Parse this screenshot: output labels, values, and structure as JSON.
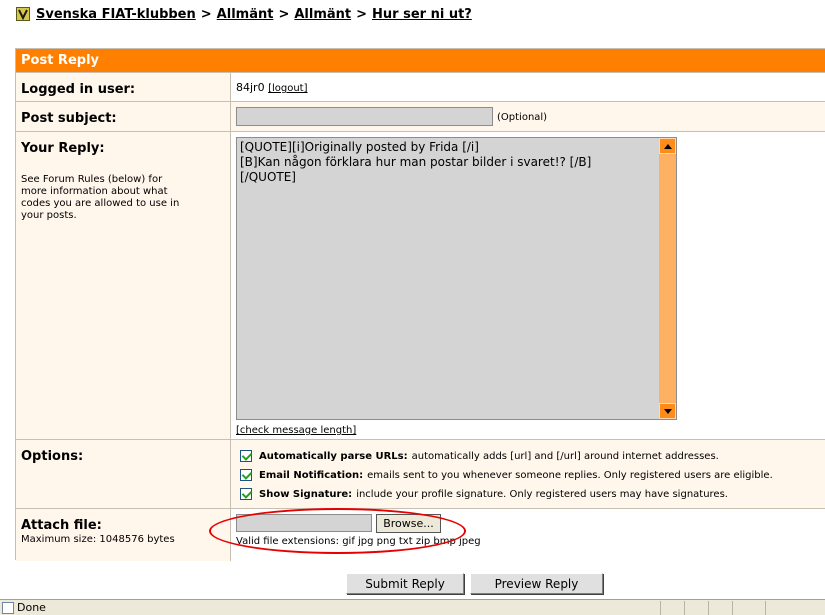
{
  "breadcrumb": {
    "items": [
      "Svenska FIAT-klubben",
      "Allmänt",
      "Allmänt",
      "Hur ser ni ut?"
    ],
    "separator": ">"
  },
  "form": {
    "header": "Post Reply",
    "logged_in": {
      "label": "Logged in user:",
      "username": "84jr0",
      "logout": "[logout]"
    },
    "subject": {
      "label": "Post subject:",
      "value": "",
      "optional": "(Optional)"
    },
    "reply": {
      "label": "Your Reply:",
      "help": "See Forum Rules (below) for more information about what codes you are allowed to use in your posts.",
      "lines": [
        "[QUOTE][i]Originally posted by Frida [/i]",
        "[B]Kan någon förklara hur man postar bilder i svaret!? [/B]",
        "[/QUOTE]"
      ],
      "check_length": "[check message length]"
    },
    "options": {
      "label": "Options:",
      "items": [
        {
          "title": "Automatically parse URLs:",
          "desc": "automatically adds [url] and [/url] around internet addresses.",
          "checked": true
        },
        {
          "title": "Email Notification:",
          "desc": "emails sent to you whenever someone replies. Only registered users are eligible.",
          "checked": true
        },
        {
          "title": "Show Signature:",
          "desc": "include your profile signature. Only registered users may have signatures.",
          "checked": true
        }
      ]
    },
    "attach": {
      "label": "Attach file:",
      "max_size": "Maximum size: 1048576 bytes",
      "browse": "Browse...",
      "extensions": "Valid file extensions: gif jpg png txt zip bmp jpeg"
    }
  },
  "buttons": {
    "submit": "Submit Reply",
    "preview": "Preview Reply"
  },
  "status": {
    "text": "Done"
  },
  "colors": {
    "header": "#ff8000",
    "label_bg": "#fff6ec",
    "annotation": "#e60000"
  }
}
